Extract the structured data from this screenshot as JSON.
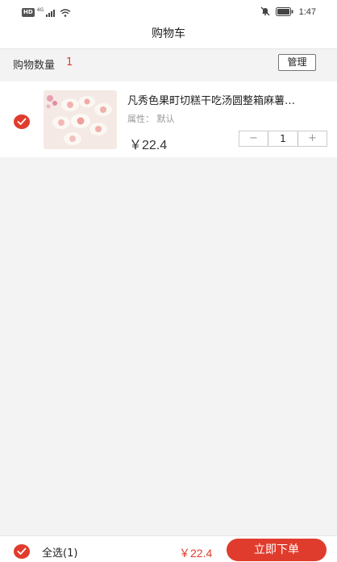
{
  "status_bar": {
    "hd_badge": "HD",
    "network_badge": "4G",
    "time": "1:47",
    "icons": [
      "signal-icon",
      "wifi-icon",
      "mute-icon",
      "battery-icon"
    ]
  },
  "header": {
    "title": "购物车"
  },
  "cart_summary": {
    "label": "购物数量",
    "count": "1",
    "manage_label": "管理"
  },
  "items": [
    {
      "name": "凡秀色果町切糕干吃汤圆整箱麻薯…",
      "attribute": "属性：  默认",
      "price": "￥22.4",
      "quantity": "1",
      "decrement_label": "−",
      "increment_label": "+",
      "selected": true
    }
  ],
  "footer": {
    "select_all_label": "全选(1)",
    "total": "￥22.4",
    "order_label": "立即下单"
  },
  "colors": {
    "accent": "#e03c2d",
    "background": "#f3f3f3",
    "card": "#ffffff"
  }
}
